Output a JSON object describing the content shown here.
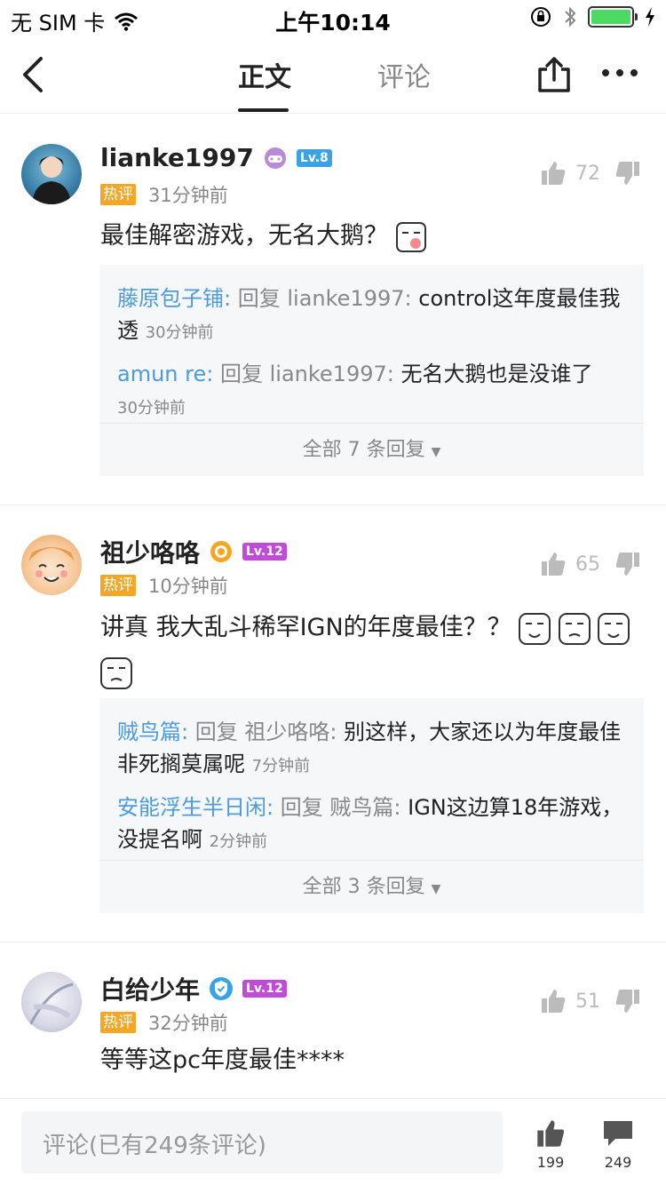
{
  "status_bar": {
    "carrier": "无 SIM 卡",
    "time": "上午10:14"
  },
  "nav": {
    "tab_main": "正文",
    "tab_comments": "评论"
  },
  "comments": [
    {
      "username": "lianke1997",
      "level": "Lv.8",
      "level_color": "#3aa3e8",
      "hot_label": "热评",
      "time": "31分钟前",
      "text": "最佳解密游戏，无名大鹅？",
      "likes": "72",
      "replies": [
        {
          "name": "藤原包子铺:",
          "reply_word": "回复",
          "target": "lianke1997:",
          "text": "control这年度最佳我透",
          "time": "30分钟前"
        },
        {
          "name": "amun re:",
          "reply_word": "回复",
          "target": "lianke1997:",
          "text": "无名大鹅也是没谁了",
          "time": "30分钟前"
        }
      ],
      "more_replies": "全部 7 条回复"
    },
    {
      "username": "祖少咯咯",
      "level": "Lv.12",
      "level_color": "#c04bd8",
      "hot_label": "热评",
      "time": "10分钟前",
      "text": "讲真  我大乱斗稀罕IGN的年度最佳？？",
      "likes": "65",
      "replies": [
        {
          "name": "贼鸟篇:",
          "reply_word": "回复",
          "target": "祖少咯咯:",
          "text": "别这样，大家还以为年度最佳非死搁莫属呢",
          "time": "7分钟前"
        },
        {
          "name": "安能浮生半日闲:",
          "reply_word": "回复",
          "target": "贼鸟篇:",
          "text": "IGN这边算18年游戏，没提名啊",
          "time": "2分钟前"
        }
      ],
      "more_replies": "全部 3 条回复"
    },
    {
      "username": "白给少年",
      "level": "Lv.12",
      "level_color": "#c04bd8",
      "hot_label": "热评",
      "time": "32分钟前",
      "text": "等等这pc年度最佳****",
      "likes": "51"
    }
  ],
  "bottom_bar": {
    "comment_placeholder": "评论(已有249条评论)",
    "like_count": "199",
    "comment_count": "249"
  },
  "colors": {
    "accent_blue": "#4a9be0",
    "hot_orange": "#f5a623",
    "battery_green": "#4cd964"
  }
}
